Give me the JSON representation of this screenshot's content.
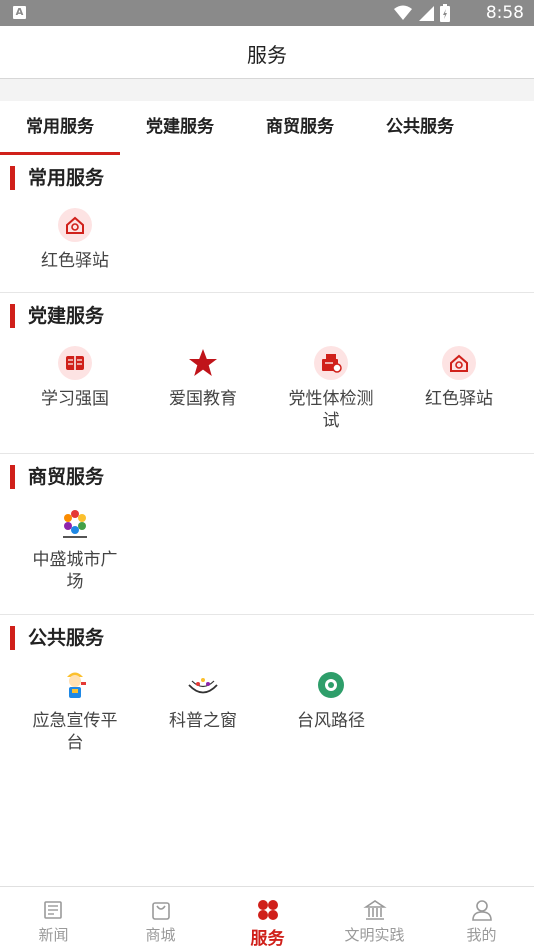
{
  "statusbar": {
    "badge": "A",
    "time": "8:58"
  },
  "header": {
    "title": "服务"
  },
  "tabs": [
    {
      "label": "常用服务"
    },
    {
      "label": "党建服务"
    },
    {
      "label": "商贸服务"
    },
    {
      "label": "公共服务"
    }
  ],
  "sections": {
    "common": {
      "title": "常用服务",
      "items": [
        {
          "label": "红色驿站",
          "icon": "house-emblem-icon"
        }
      ]
    },
    "party": {
      "title": "党建服务",
      "items": [
        {
          "label": "学习强国",
          "icon": "book-icon"
        },
        {
          "label": "爱国教育",
          "icon": "star-icon"
        },
        {
          "label": "党性体检测试",
          "icon": "test-kit-icon"
        },
        {
          "label": "红色驿站",
          "icon": "house-emblem-icon"
        }
      ]
    },
    "commerce": {
      "title": "商贸服务",
      "items": [
        {
          "label": "中盛城市广场",
          "icon": "plaza-logo-icon"
        }
      ]
    },
    "public": {
      "title": "公共服务",
      "items": [
        {
          "label": "应急宣传平台",
          "icon": "worker-mascot-icon"
        },
        {
          "label": "科普之窗",
          "icon": "science-logo-icon"
        },
        {
          "label": "台风路径",
          "icon": "typhoon-icon"
        }
      ]
    }
  },
  "nav": [
    {
      "label": "新闻",
      "icon": "newspaper-icon"
    },
    {
      "label": "商城",
      "icon": "shopping-bag-icon"
    },
    {
      "label": "服务",
      "icon": "services-cluster-icon"
    },
    {
      "label": "文明实践",
      "icon": "museum-icon"
    },
    {
      "label": "我的",
      "icon": "person-icon"
    }
  ],
  "colors": {
    "accent": "#d0201a",
    "icon_bg": "#fde3e3",
    "statusbar": "#8a8a8a"
  }
}
